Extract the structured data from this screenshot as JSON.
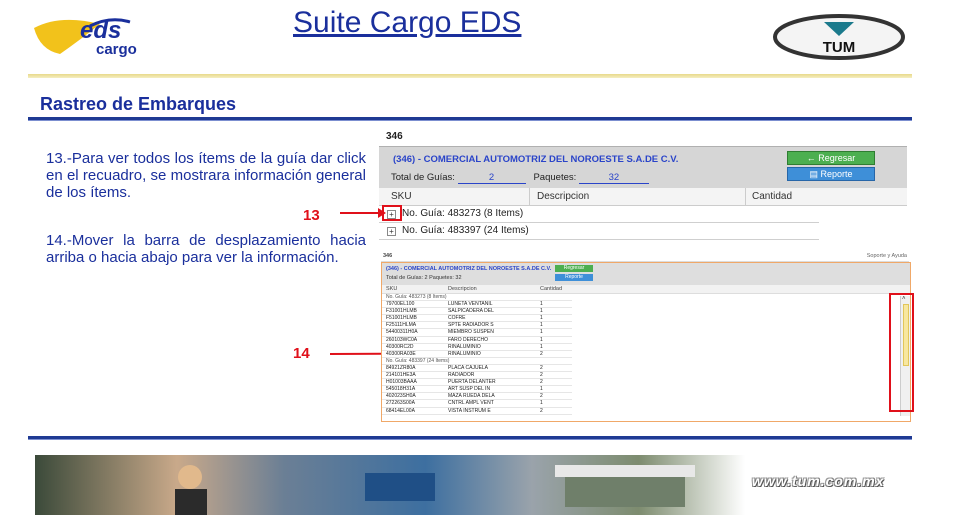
{
  "header": {
    "title": "Suite Cargo EDS",
    "logo_left_text": "eds",
    "logo_left_sub": "cargo",
    "logo_right_text": "TUM"
  },
  "section": {
    "title": "Rastreo de Embarques"
  },
  "instructions": {
    "step13": "13.-Para ver todos los ítems de la guía dar click en el recuadro, se mostrara información general de los ítems.",
    "step14": "14.-Mover la barra de desplazamiento hacia arriba o hacia abajo para ver la información."
  },
  "callouts": {
    "c13": "13",
    "c14": "14"
  },
  "panel1": {
    "id_label": "346",
    "company": "(346) - COMERCIAL AUTOMOTRIZ DEL NOROESTE S.A.DE C.V.",
    "total_guias_label": "Total de Guías:",
    "total_guias_value": "2",
    "paquetes_label": "Paquetes:",
    "paquetes_value": "32",
    "btn_regresar": "Regresar",
    "btn_reporte": "Reporte",
    "columns": [
      "SKU",
      "Descripcion",
      "Cantidad"
    ],
    "groups": [
      {
        "label": "No. Guía: 483273 (8 Items)"
      },
      {
        "label": "No. Guía: 483397 (24 Items)"
      }
    ]
  },
  "panel2": {
    "id_label": "346",
    "help": "Soporte y Ayuda",
    "company": "(346) - COMERCIAL AUTOMOTRIZ DEL NOROESTE S.A.DE C.V.",
    "total_line": "Total de Guías: 2    Paquetes: 32",
    "btn_regresar": "Regresar",
    "btn_reporte": "Reporte",
    "columns": [
      "SKU",
      "Descripcion",
      "Cantidad"
    ],
    "rows": [
      {
        "group": "No. Guía: 483273 (8 Items)"
      },
      {
        "sku": "79700EL100",
        "desc": "LUNETA VENTANIL",
        "cant": "1"
      },
      {
        "sku": "F31001HLMB",
        "desc": "SALPICADERA DEL",
        "cant": "1"
      },
      {
        "sku": "F51001HLMB",
        "desc": "COFRE",
        "cant": "1"
      },
      {
        "sku": "F25111HLMA",
        "desc": "SPTE RADIADOR S",
        "cant": "1"
      },
      {
        "sku": "54400311H0A",
        "desc": "MIEMBRO SUSPEN",
        "cant": "1"
      },
      {
        "sku": "260103WC0A",
        "desc": "FARO DERECHO",
        "cant": "1"
      },
      {
        "sku": "40300RC2D",
        "desc": "RINALUMINIO",
        "cant": "1"
      },
      {
        "sku": "40300RA03E",
        "desc": "RINALUMINIO",
        "cant": "2"
      },
      {
        "group": "No. Guía: 483397 (24 Items)"
      },
      {
        "sku": "84921ZR80A",
        "desc": "PLACA CAJUELA",
        "cant": "2"
      },
      {
        "sku": "214101HE3A",
        "desc": "RADIADOR",
        "cant": "2"
      },
      {
        "sku": "H01003BAAA",
        "desc": "PUERTA DELANTER",
        "cant": "2"
      },
      {
        "sku": "545018H31A",
        "desc": "ART SUSP DEL IN",
        "cant": "1"
      },
      {
        "sku": "402023SH0A",
        "desc": "MAZA RUEDA DELA",
        "cant": "2"
      },
      {
        "sku": "272263S00A",
        "desc": "CNTRL AMPL VENT",
        "cant": "1"
      },
      {
        "sku": "68414EL00A",
        "desc": "VISTA INSTRUM E",
        "cant": "2"
      }
    ]
  },
  "footer": {
    "url": "www.tum.com.mx"
  },
  "colors": {
    "title_blue": "#1a2f9c",
    "accent_red": "#e0101a",
    "rule_navy": "#1f3a93",
    "btn_green": "#4caf50",
    "btn_blue": "#3e8fd8"
  }
}
